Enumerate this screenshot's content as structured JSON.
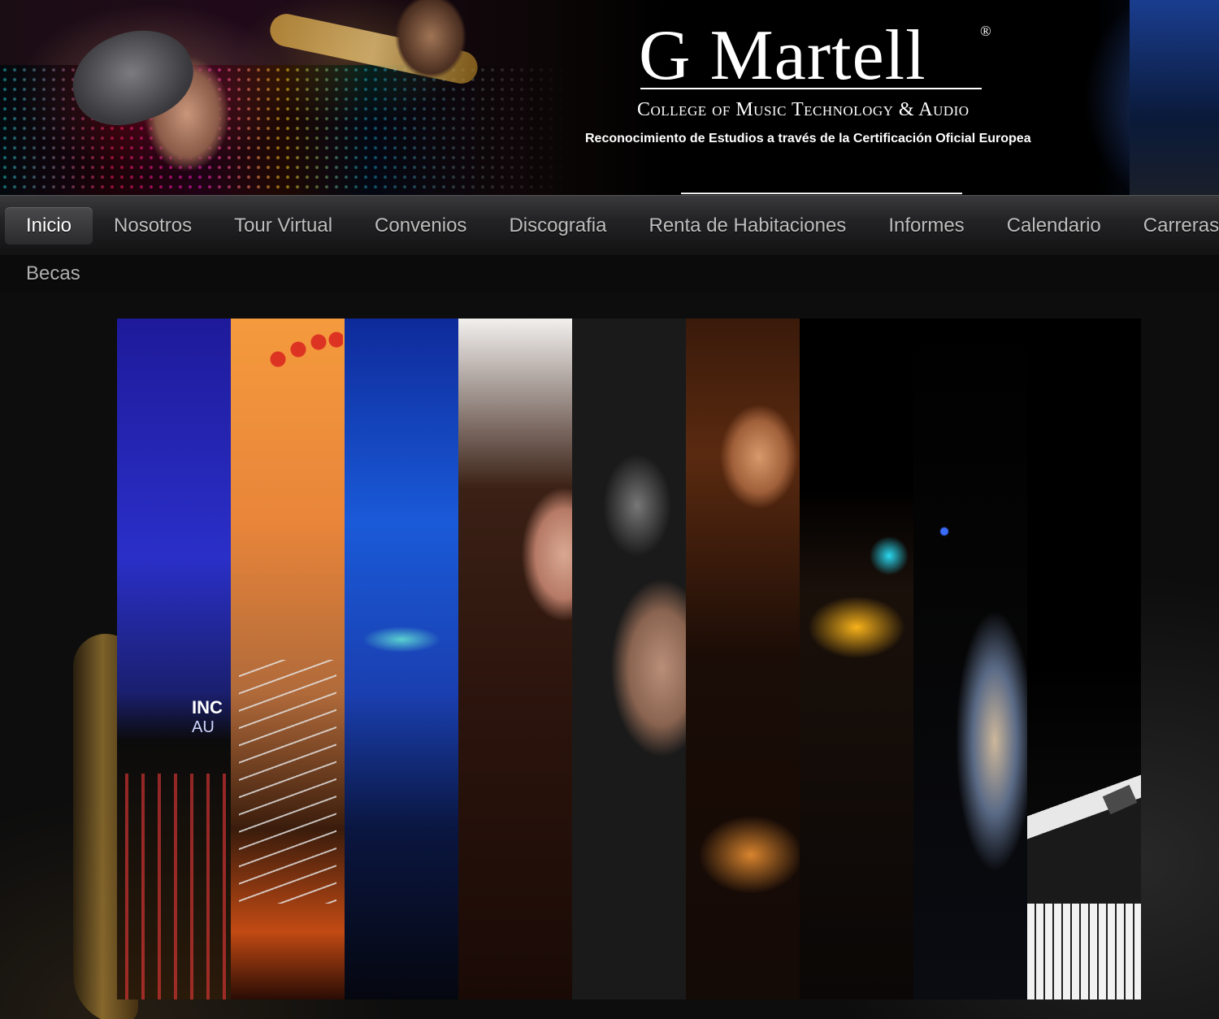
{
  "header": {
    "logo_title": "G Martell",
    "logo_registered": "®",
    "logo_subtitle": "College of Music Technology & Audio",
    "tagline": "Reconocimiento de Estudios a través de la Certificación Oficial Europea"
  },
  "nav": {
    "items": [
      {
        "label": "Inicio",
        "active": true
      },
      {
        "label": "Nosotros",
        "active": false
      },
      {
        "label": "Tour Virtual",
        "active": false
      },
      {
        "label": "Convenios",
        "active": false
      },
      {
        "label": "Discografia",
        "active": false
      },
      {
        "label": "Renta de Habitaciones",
        "active": false
      },
      {
        "label": "Informes",
        "active": false
      },
      {
        "label": "Calendario",
        "active": false
      },
      {
        "label": "Carreras",
        "active": false
      }
    ],
    "row2": [
      {
        "label": "Becas",
        "active": false
      }
    ]
  },
  "slider": {
    "strip1_text_line1": "INC",
    "strip1_text_line2": "AU"
  },
  "colors": {
    "nav_text": "#bdbdbd",
    "nav_active_text": "#ffffff",
    "page_bg": "#0b0b0b"
  }
}
